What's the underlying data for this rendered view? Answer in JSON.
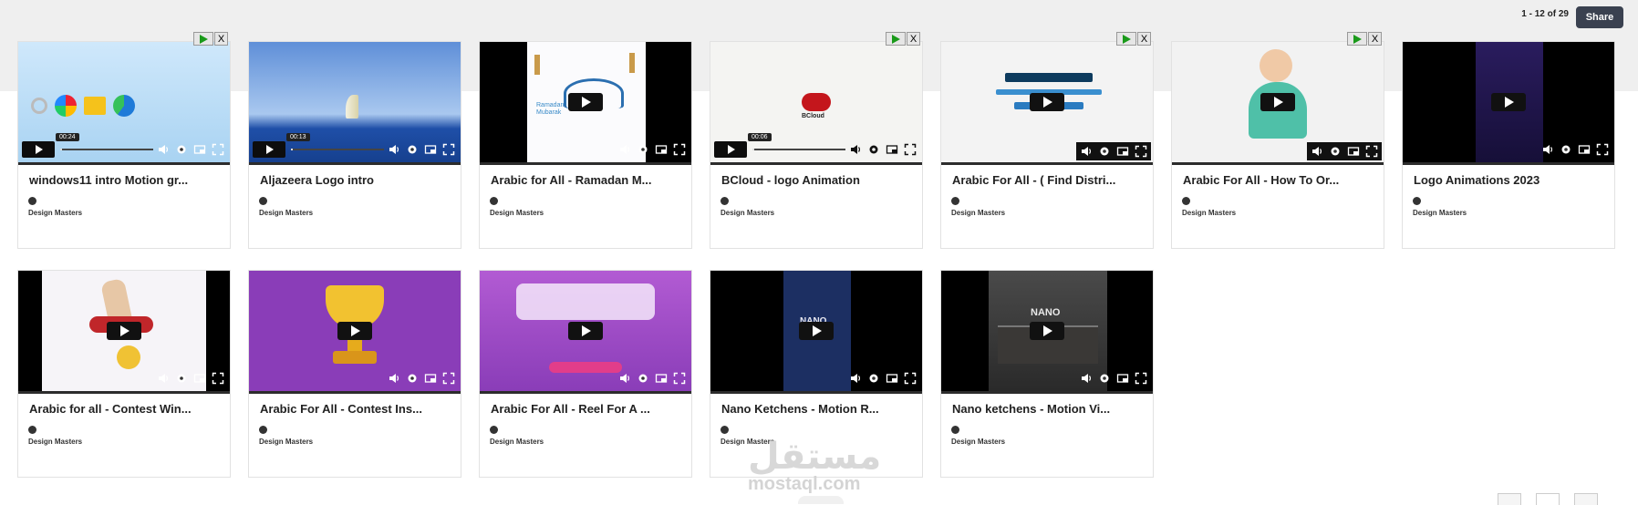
{
  "header": {
    "count": "1 - 12 of 29",
    "share_label": "Share"
  },
  "videos": [
    {
      "title": "windows11 intro Motion gr...",
      "author": "Design Masters",
      "time": "00:24",
      "progress": 0.02,
      "ad": true
    },
    {
      "title": "Aljazeera Logo intro",
      "author": "Design Masters",
      "time": "00:13",
      "progress": 0.02,
      "ad": false
    },
    {
      "title": "Arabic for All - Ramadan M...",
      "author": "Design Masters",
      "ad": false
    },
    {
      "title": "BCloud - logo Animation",
      "author": "Design Masters",
      "time": "00:06",
      "progress": 0.02,
      "ad": true
    },
    {
      "title": "Arabic For All - ( Find Distri...",
      "author": "Design Masters",
      "ad": true
    },
    {
      "title": "Arabic For All - How To Or...",
      "author": "Design Masters",
      "ad": true
    },
    {
      "title": "Logo Animations 2023",
      "author": "Design Masters",
      "ad": false
    },
    {
      "title": "Arabic for all - Contest Win...",
      "author": "Design Masters",
      "ad": false
    },
    {
      "title": "Arabic For All - Contest Ins...",
      "author": "Design Masters",
      "ad": false
    },
    {
      "title": "Arabic For All - Reel For A ...",
      "author": "Design Masters",
      "ad": false
    },
    {
      "title": "Nano Ketchens - Motion R...",
      "author": "Design Masters",
      "ad": false
    },
    {
      "title": "Nano ketchens - Motion Vi...",
      "author": "Design Masters",
      "ad": false
    }
  ],
  "thumb_texts": {
    "bcloud": "BCloud",
    "ramadan": "Ramadan Mubarak",
    "nano": "NANO"
  },
  "watermark": {
    "arabic": "مستقل",
    "url": "mostaql.com"
  },
  "ad_close": "X",
  "colors": {
    "share_bg": "#3a4150",
    "ad_play": "#1a9a1a",
    "purple": "#8a3db8"
  }
}
